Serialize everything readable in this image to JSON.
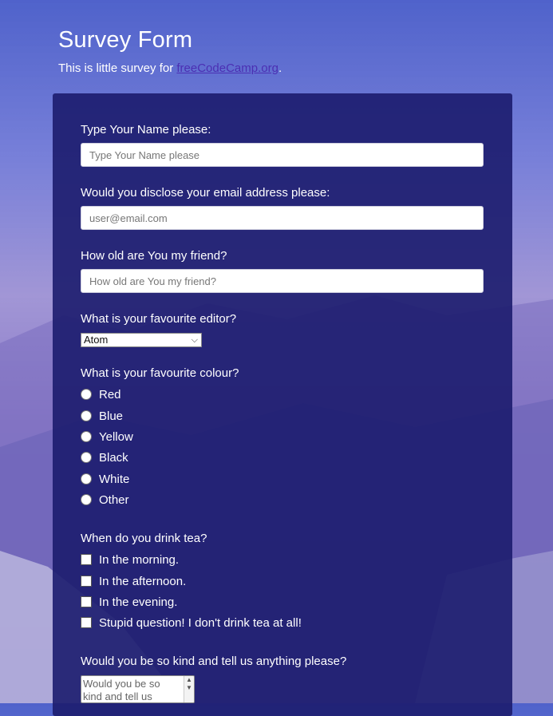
{
  "header": {
    "title": "Survey Form",
    "subtitle_prefix": "This is little survey for ",
    "subtitle_link": "freeCodeCamp.org",
    "subtitle_suffix": "."
  },
  "form": {
    "name_label": "Type Your Name please:",
    "name_placeholder": "Type Your Name please",
    "email_label": "Would you disclose your email address please:",
    "email_placeholder": "user@email.com",
    "age_label": "How old are You my friend?",
    "age_placeholder": "How old are You my friend?",
    "editor_label": "What is your favourite editor?",
    "editor_selected": "Atom",
    "colour_label": "What is your favourite colour?",
    "colours": [
      "Red",
      "Blue",
      "Yellow",
      "Black",
      "White",
      "Other"
    ],
    "tea_label": "When do you drink tea?",
    "tea_options": [
      "In the morning.",
      "In the afternoon.",
      "In the evening.",
      "Stupid question! I don't drink tea at all!"
    ],
    "comments_label": "Would you be so kind and tell us anything please?",
    "comments_placeholder": "Would you be so kind and tell us"
  },
  "colors": {
    "card": "#1c1c6e",
    "link": "#4b2fb3"
  }
}
